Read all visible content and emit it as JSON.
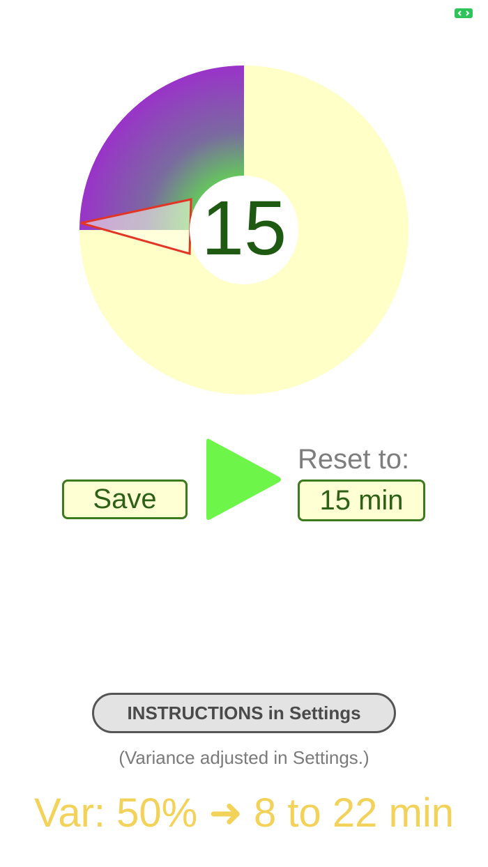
{
  "status_bar": {
    "icon": "screen-rotation-icon",
    "icon_color": "#2ec45a"
  },
  "timer": {
    "minutes_display": "15",
    "elapsed_fraction": 0.25,
    "arc_color_start": "#9a33c9",
    "arc_color_end": "#5fe04a",
    "remaining_color": "#ffffc8",
    "variance_marker_color": "#e33525",
    "number_color": "#1f5a12"
  },
  "controls": {
    "save_label": "Save",
    "play_icon": "play-icon",
    "play_color": "#6ef54a",
    "reset_label": "Reset to:",
    "reset_value": "15 min"
  },
  "footer": {
    "instructions_label": "INSTRUCTIONS in Settings",
    "variance_note": "(Variance adjusted in Settings.)",
    "variance_summary": "Var: 50% ➜ 8 to 22 min",
    "summary_color": "#f3d25a"
  }
}
